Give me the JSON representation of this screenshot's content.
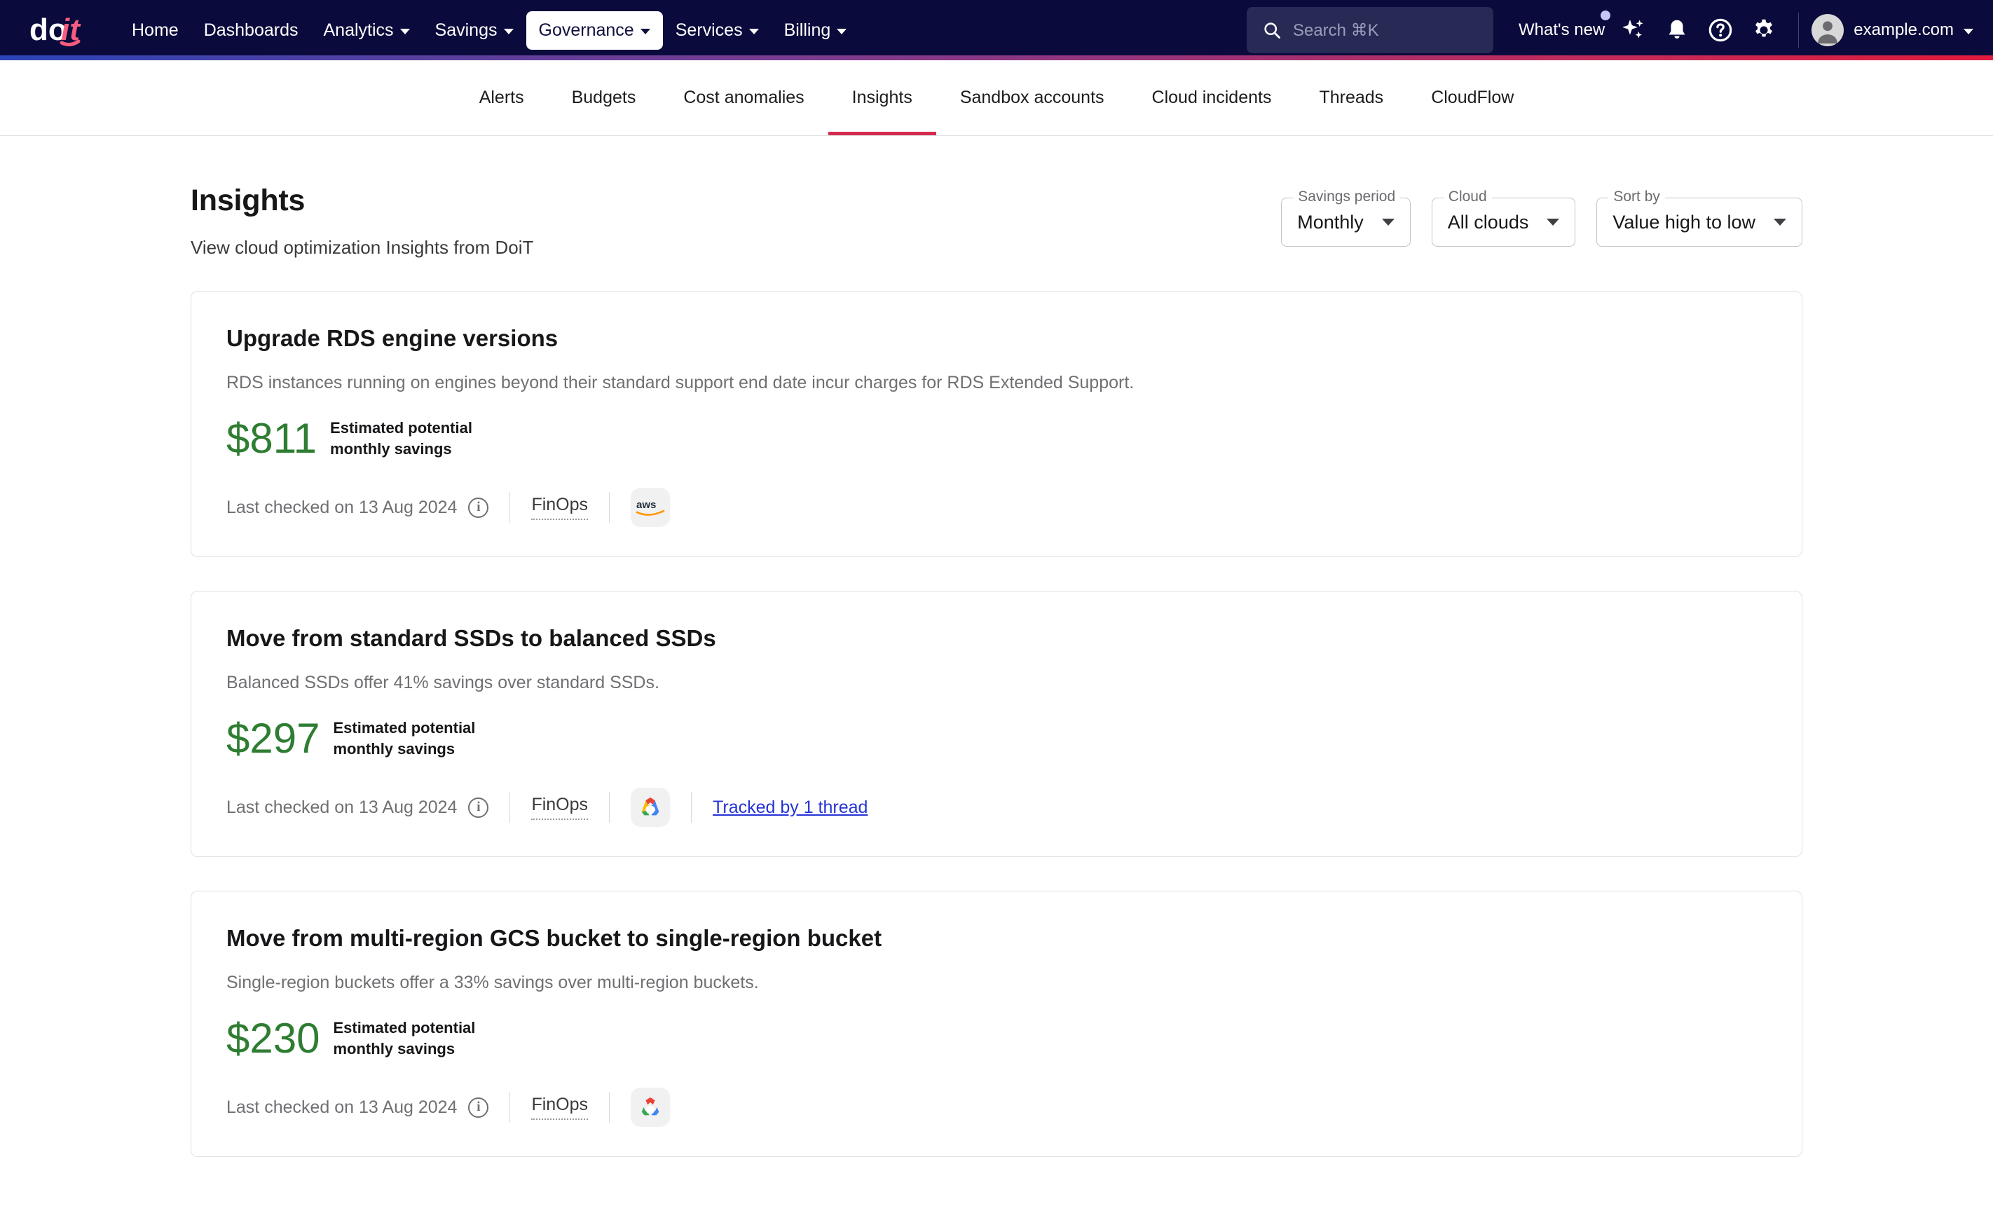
{
  "topnav": {
    "logo_alt": "doit",
    "links": [
      {
        "label": "Home",
        "has_caret": false,
        "active": false
      },
      {
        "label": "Dashboards",
        "has_caret": false,
        "active": false
      },
      {
        "label": "Analytics",
        "has_caret": true,
        "active": false
      },
      {
        "label": "Savings",
        "has_caret": true,
        "active": false
      },
      {
        "label": "Governance",
        "has_caret": true,
        "active": true
      },
      {
        "label": "Services",
        "has_caret": true,
        "active": false
      },
      {
        "label": "Billing",
        "has_caret": true,
        "active": false
      }
    ],
    "search_placeholder": "Search ⌘K",
    "whats_new_label": "What's new",
    "account_label": "example.com",
    "accent_gradient": [
      "#2b44b8",
      "#7b3c90",
      "#e01b3c"
    ],
    "background": "#0a0a3c"
  },
  "subnav": {
    "tabs": [
      {
        "label": "Alerts",
        "active": false
      },
      {
        "label": "Budgets",
        "active": false
      },
      {
        "label": "Cost anomalies",
        "active": false
      },
      {
        "label": "Insights",
        "active": true
      },
      {
        "label": "Sandbox accounts",
        "active": false
      },
      {
        "label": "Cloud incidents",
        "active": false
      },
      {
        "label": "Threads",
        "active": false
      },
      {
        "label": "CloudFlow",
        "active": false
      }
    ],
    "active_color": "#d62b4e"
  },
  "page": {
    "title": "Insights",
    "subtitle": "View cloud optimization Insights from DoiT"
  },
  "filters": [
    {
      "legend": "Savings period",
      "value": "Monthly",
      "name": "savings-period"
    },
    {
      "legend": "Cloud",
      "value": "All clouds",
      "name": "cloud"
    },
    {
      "legend": "Sort by",
      "value": "Value high to low",
      "name": "sort-by"
    }
  ],
  "cards": [
    {
      "title": "Upgrade RDS engine versions",
      "description": "RDS instances running on engines beyond their standard support end date incur charges for RDS Extended Support.",
      "amount": "$811",
      "savings_label_line1": "Estimated potential",
      "savings_label_line2": "monthly savings",
      "last_checked": "Last checked on 13 Aug 2024",
      "category": "FinOps",
      "cloud": "aws",
      "thread_link": null
    },
    {
      "title": "Move from standard SSDs to balanced SSDs",
      "description": "Balanced SSDs offer 41% savings over standard SSDs.",
      "amount": "$297",
      "savings_label_line1": "Estimated potential",
      "savings_label_line2": "monthly savings",
      "last_checked": "Last checked on 13 Aug 2024",
      "category": "FinOps",
      "cloud": "gcp",
      "thread_link": "Tracked by 1 thread"
    },
    {
      "title": "Move from multi-region GCS bucket to single-region bucket",
      "description": "Single-region buckets offer a 33% savings over multi-region buckets.",
      "amount": "$230",
      "savings_label_line1": "Estimated potential",
      "savings_label_line2": "monthly savings",
      "last_checked": "Last checked on 13 Aug 2024",
      "category": "FinOps",
      "cloud": "gcp",
      "thread_link": null
    }
  ],
  "colors": {
    "savings_green": "#2e7d32",
    "link_blue": "#2534d6",
    "muted_text": "#707074"
  }
}
